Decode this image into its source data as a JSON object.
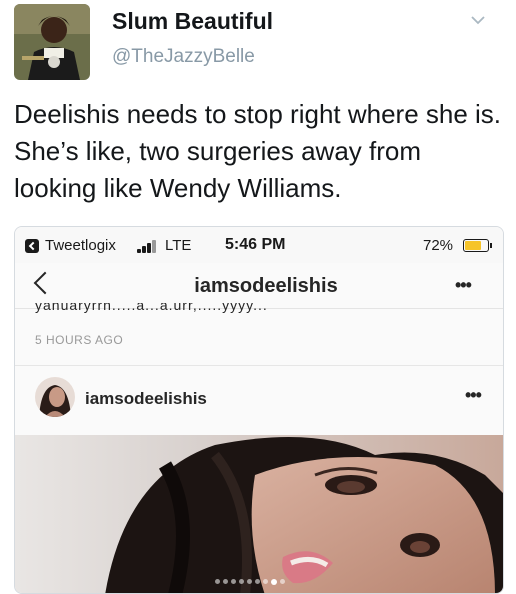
{
  "tweet": {
    "display_name": "Slum Beautiful",
    "handle": "@TheJazzyBelle",
    "text": "Deelishis needs to stop right where she is. She’s like, two surgeries away from looking like Wendy Williams.",
    "avatar_icon": "avatar-photo",
    "caret_icon": "chevron-down-icon"
  },
  "embedded_screenshot": {
    "status_bar": {
      "back_app": "Tweetlogix",
      "network": "LTE",
      "time": "5:46 PM",
      "battery": "72%",
      "battery_level": 0.72,
      "battery_color": "#f6c42a"
    },
    "nav": {
      "title": "iamsodeelishis",
      "back_icon": "back-chevron-icon",
      "more_icon": "more-dots-icon",
      "more_label": "•••"
    },
    "cut_caption": "yanuaryrrn.....a...a.urr,.....yyyy...",
    "time_ago": "5 HOURS AGO",
    "post": {
      "username": "iamsodeelishis",
      "more_label": "•••",
      "carousel_total": 9,
      "carousel_active": 8
    }
  }
}
